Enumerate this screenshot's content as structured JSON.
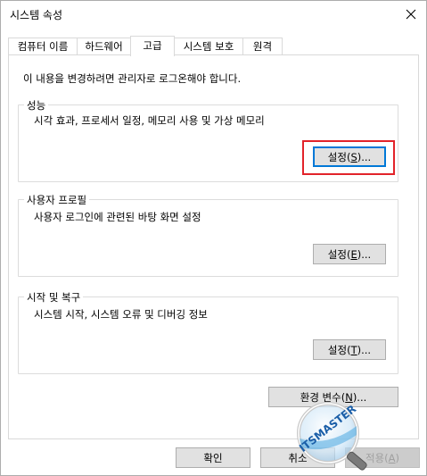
{
  "window": {
    "title": "시스템 속성"
  },
  "tabs": [
    {
      "label": "컴퓨터 이름",
      "active": false
    },
    {
      "label": "하드웨어",
      "active": false
    },
    {
      "label": "고급",
      "active": true
    },
    {
      "label": "시스템 보호",
      "active": false
    },
    {
      "label": "원격",
      "active": false
    }
  ],
  "notice": "이 내용을 변경하려면 관리자로 로그온해야 합니다.",
  "groups": {
    "performance": {
      "title": "성능",
      "description": "시각 효과, 프로세서 일정, 메모리 사용 및 가상 메모리",
      "button": {
        "pre": "설정(",
        "accel": "S",
        "post": ")..."
      }
    },
    "user_profile": {
      "title": "사용자 프로필",
      "description": "사용자 로그인에 관련된 바탕 화면 설정",
      "button": {
        "pre": "설정(",
        "accel": "E",
        "post": ")..."
      }
    },
    "startup_recovery": {
      "title": "시작 및 복구",
      "description": "시스템 시작, 시스템 오류 및 디버깅 정보",
      "button": {
        "pre": "설정(",
        "accel": "T",
        "post": ")..."
      }
    }
  },
  "env_button": {
    "pre": "환경 변수(",
    "accel": "N",
    "post": ")..."
  },
  "footer": {
    "ok": "확인",
    "cancel": "취소",
    "apply": {
      "pre": "적용(",
      "accel": "A",
      "post": ")"
    }
  },
  "watermark": {
    "text": "ITSMASTER"
  },
  "colors": {
    "highlight": "#e2232a",
    "focus": "#0078d7",
    "button_face": "#e1e1e1"
  }
}
